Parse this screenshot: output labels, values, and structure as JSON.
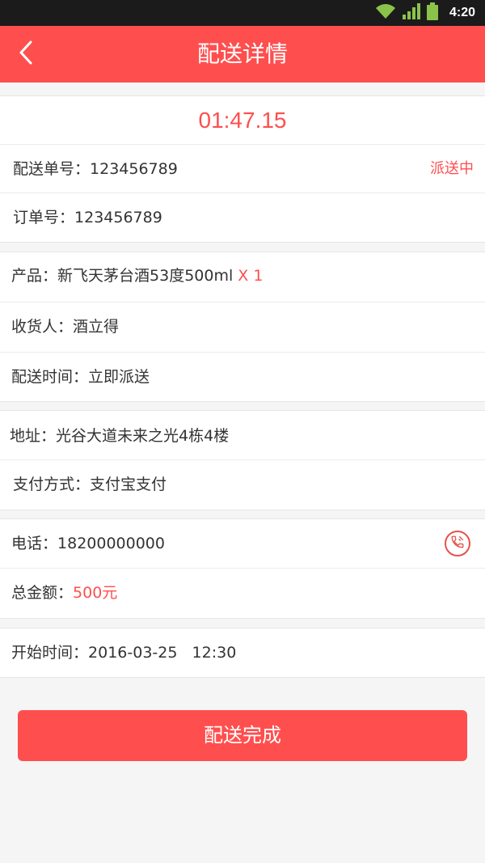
{
  "status_bar": {
    "time": "4:20"
  },
  "header": {
    "title": "配送详情"
  },
  "timer": "01:47.15",
  "section1": {
    "delivery_no_label": "配送单号：",
    "delivery_no": "123456789",
    "status": "派送中",
    "order_no_label": "订单号：",
    "order_no": "123456789"
  },
  "section2": {
    "product_label": "产品：",
    "product_name": "新飞天茅台酒53度500ml",
    "product_qty": "X 1",
    "receiver_label": "收货人：",
    "receiver": "酒立得",
    "delivery_time_label": "配送时间：",
    "delivery_time": "立即派送"
  },
  "section3": {
    "address_label": "地址：",
    "address": "光谷大道未来之光4栋4楼",
    "payment_label": "支付方式：",
    "payment": "支付宝支付"
  },
  "section4": {
    "phone_label": "电话：",
    "phone": "18200000000",
    "total_label": "总金额：",
    "total": "500元"
  },
  "section5": {
    "start_time_label": "开始时间：",
    "start_time": "2016-03-25   12:30"
  },
  "done_button": "配送完成",
  "colors": {
    "accent": "#ff4e4e",
    "background": "#f5f5f5"
  }
}
